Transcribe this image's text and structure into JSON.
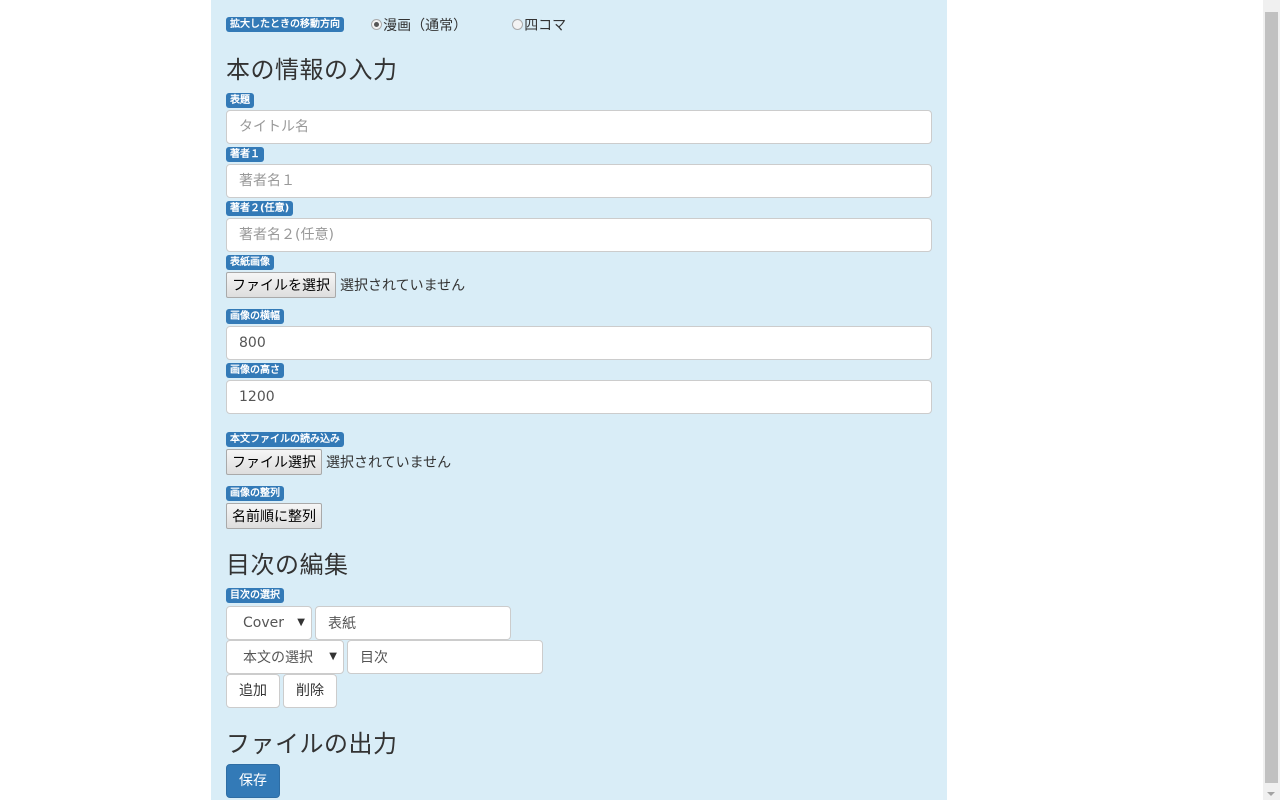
{
  "direction": {
    "label": "拡大したときの移動方向",
    "options": [
      {
        "label": "漫画（通常）",
        "checked": true
      },
      {
        "label": "四コマ",
        "checked": false
      }
    ]
  },
  "book_info": {
    "heading": "本の情報の入力",
    "title": {
      "label": "表題",
      "placeholder": "タイトル名",
      "value": ""
    },
    "author1": {
      "label": "著者１",
      "placeholder": "著者名１",
      "value": ""
    },
    "author2": {
      "label": "著者２(任意)",
      "placeholder": "著者名２(任意)",
      "value": ""
    },
    "cover_image": {
      "label": "表紙画像",
      "button": "ファイルを選択",
      "status": "選択されていません"
    },
    "image_width": {
      "label": "画像の横幅",
      "value": "800"
    },
    "image_height": {
      "label": "画像の高さ",
      "value": "1200"
    },
    "body_file": {
      "label": "本文ファイルの読み込み",
      "button": "ファイル選択",
      "status": "選択されていません"
    },
    "image_sort": {
      "label": "画像の整列",
      "button": "名前順に整列"
    }
  },
  "toc": {
    "heading": "目次の編集",
    "label": "目次の選択",
    "rows": [
      {
        "select": "Cover",
        "text": "表紙"
      },
      {
        "select": "本文の選択",
        "text": "目次"
      }
    ],
    "add_button": "追加",
    "delete_button": "削除"
  },
  "output": {
    "heading": "ファイルの出力",
    "save_button": "保存"
  },
  "colors": {
    "panel_bg": "#d9edf7",
    "label_bg": "#337ab7",
    "primary": "#337ab7"
  }
}
